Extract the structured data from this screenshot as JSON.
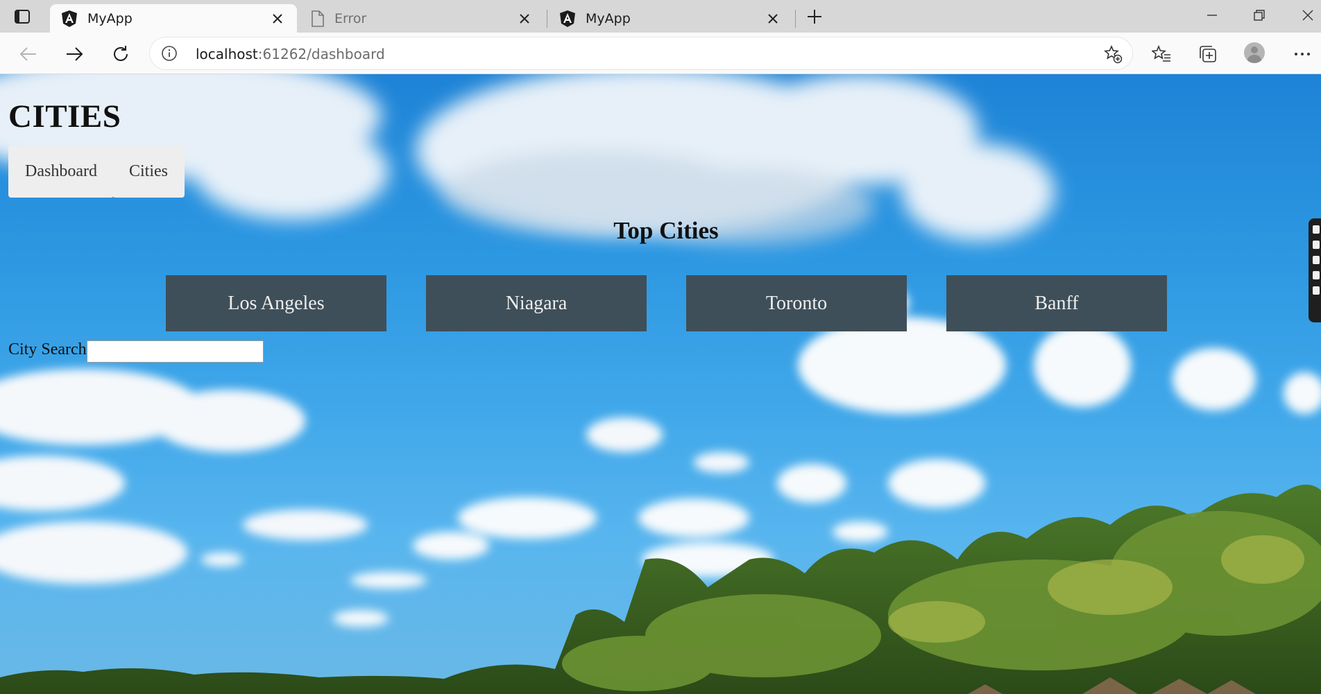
{
  "browser": {
    "tabs": [
      {
        "title": "MyApp",
        "icon": "angular-icon",
        "active": true
      },
      {
        "title": "Error",
        "icon": "page-icon",
        "active": false
      },
      {
        "title": "MyApp",
        "icon": "angular-icon",
        "active": false
      }
    ],
    "address": {
      "host": "localhost",
      "rest": ":61262/dashboard"
    }
  },
  "app": {
    "title": "CITIES",
    "nav": [
      {
        "label": "Dashboard"
      },
      {
        "label": "Cities"
      }
    ],
    "section_title": "Top Cities",
    "cities": [
      {
        "name": "Los Angeles"
      },
      {
        "name": "Niagara"
      },
      {
        "name": "Toronto"
      },
      {
        "name": "Banff"
      }
    ],
    "search": {
      "label": "City Search",
      "value": ""
    }
  },
  "colors": {
    "card_bg": "#3e4f59",
    "nav_bg": "#eeeeee",
    "sky": "#2d98e2"
  }
}
